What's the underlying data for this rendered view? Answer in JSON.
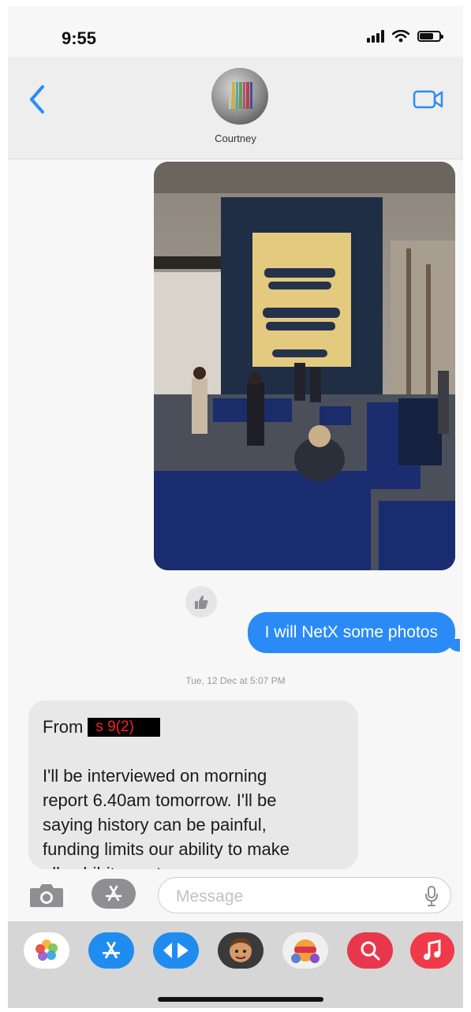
{
  "status_bar": {
    "time": "9:55"
  },
  "header": {
    "contact_name": "Courtney"
  },
  "messages": {
    "sent_text": "I will NetX some photos",
    "timestamp": "Tue, 12 Dec at 5:07 PM",
    "received": {
      "from_label": "From",
      "redaction_label": "s 9(2)",
      "body_lines": [
        "I'll be interviewed on morning",
        "report 6.40am tomorrow. I'll be",
        "saying history can be painful,",
        "funding limits our ability to make",
        "all exhibits contemporary"
      ]
    }
  },
  "composer": {
    "placeholder": "Message"
  },
  "colors": {
    "accent": "#2b8bf6",
    "sent_bubble": "#2b8bf6",
    "received_bubble": "#e8e8e8",
    "redaction_text": "#ff2020"
  },
  "app_drawer": [
    "photos-icon",
    "app-store-icon",
    "digital-touch-icon",
    "memoji-icon",
    "animoji-icon",
    "image-search-icon",
    "music-icon"
  ]
}
